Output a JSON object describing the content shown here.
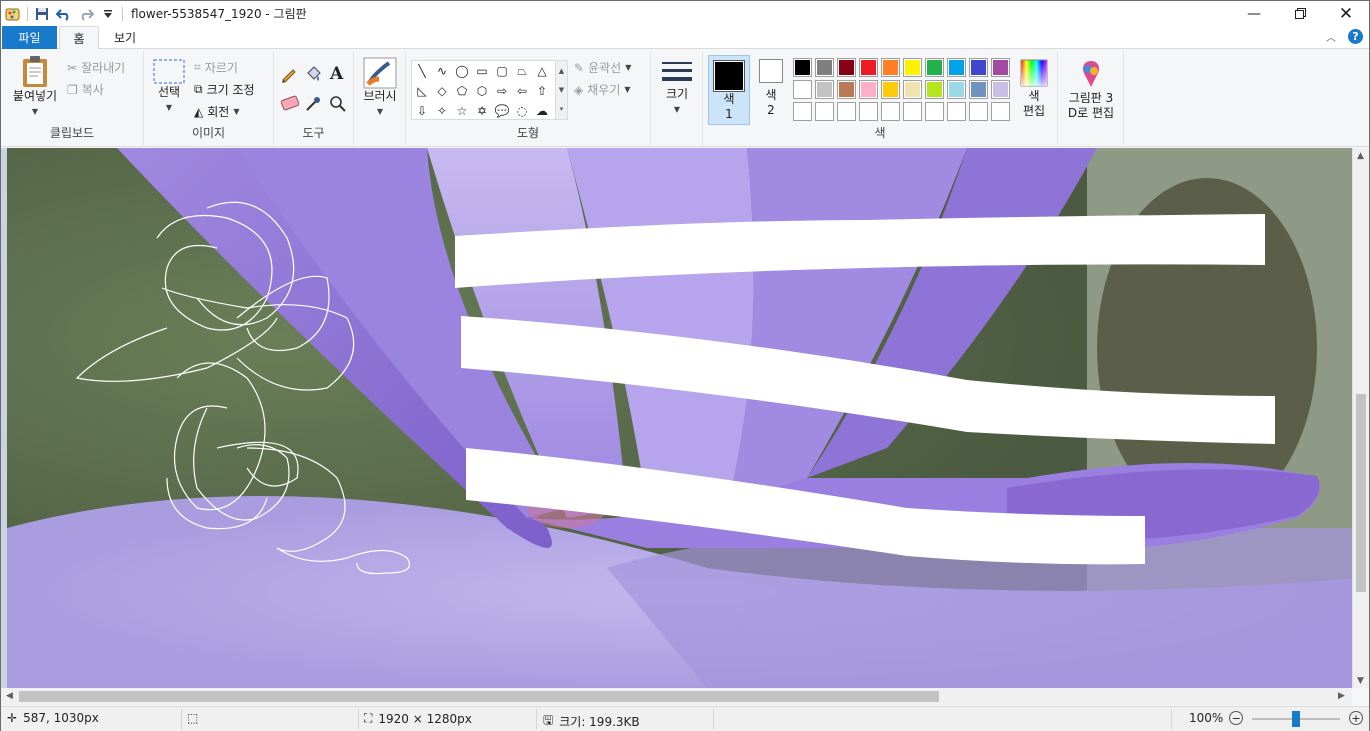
{
  "window": {
    "title": "flower-5538547_1920 - 그림판",
    "controls": [
      "minimize",
      "maximize",
      "close"
    ]
  },
  "tabs": {
    "file": "파일",
    "home": "홈",
    "view": "보기"
  },
  "ribbon": {
    "clipboard": {
      "paste": "붙여넣기",
      "cut": "잘라내기",
      "copy": "복사",
      "label": "클립보드"
    },
    "image": {
      "select": "선택",
      "crop": "자르기",
      "resize": "크기 조정",
      "rotate": "회전",
      "label": "이미지"
    },
    "tools": {
      "label": "도구"
    },
    "brushes": {
      "label": "브러시"
    },
    "shapes": {
      "outline": "윤곽선",
      "fill": "채우기",
      "label": "도형"
    },
    "size": {
      "label": "크기"
    },
    "colors": {
      "color1": "색",
      "color1_num": "1",
      "color2": "색",
      "color2_num": "2",
      "edit_colors": "색\n편집",
      "label": "색",
      "color1_value": "#000000",
      "color2_value": "#ffffff",
      "palette": [
        "#000000",
        "#7f7f7f",
        "#880015",
        "#ed1c24",
        "#ff7f27",
        "#fff200",
        "#22b14c",
        "#00a2e8",
        "#3f48cc",
        "#a349a4",
        "#ffffff",
        "#c3c3c3",
        "#b97a57",
        "#ffaec9",
        "#ffc90e",
        "#efe4b0",
        "#b5e61d",
        "#99d9ea",
        "#7092be",
        "#c8bfe7",
        "#ffffff",
        "#ffffff",
        "#ffffff",
        "#ffffff",
        "#ffffff",
        "#ffffff",
        "#ffffff",
        "#ffffff",
        "#ffffff",
        "#ffffff"
      ]
    },
    "paint3d": {
      "label": "그림판 3\nD로 편집"
    }
  },
  "status": {
    "cursor": "587, 1030px",
    "dimensions": "1920 × 1280px",
    "filesize": "크기: 199.3KB",
    "zoom": "100%"
  },
  "scroll": {
    "vertical_fraction": 0.45,
    "horizontal_fraction": 0.68
  },
  "zoom_slider": {
    "value_fraction": 0.5
  }
}
